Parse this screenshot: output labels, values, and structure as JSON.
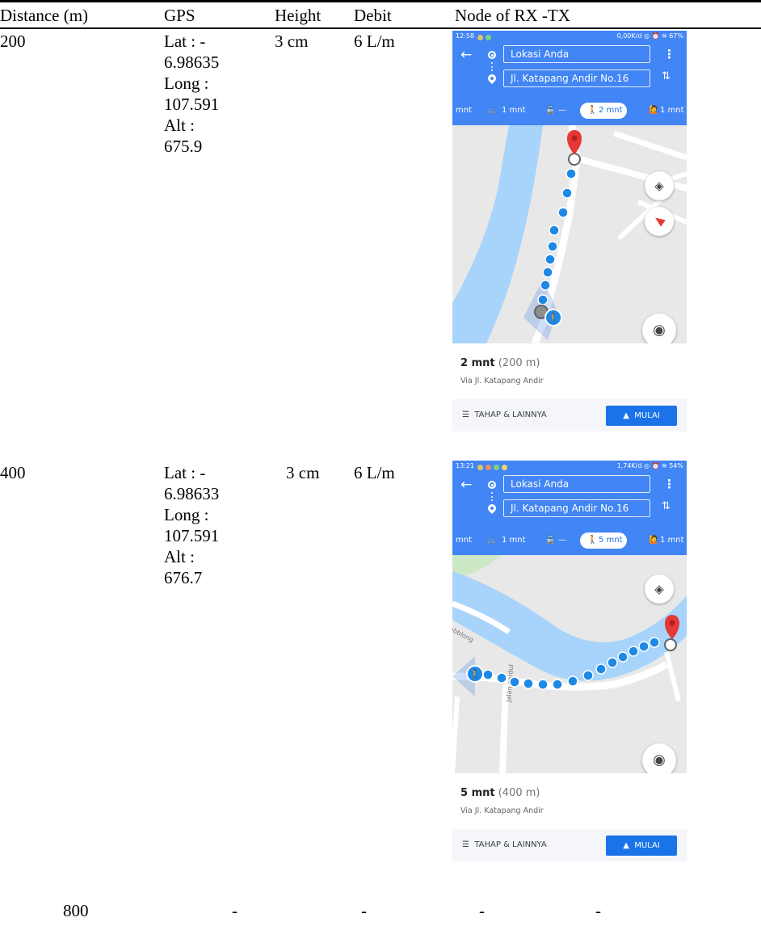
{
  "table": {
    "headers": {
      "distance": "Distance (m)",
      "gps": "GPS",
      "height": "Height",
      "debit": "Debit",
      "node": "Node of RX -TX"
    },
    "rows": [
      {
        "distance": "200",
        "gps": [
          "Lat : -",
          "6.98635",
          "Long :",
          "107.591",
          "Alt :",
          "675.9"
        ],
        "height": "3 cm",
        "debit": "6 L/m"
      },
      {
        "distance": "400",
        "gps": [
          "Lat : -",
          "6.98633",
          "Long :",
          "107.591",
          "Alt :",
          "676.7"
        ],
        "height": "3 cm",
        "debit": "6 L/m"
      },
      {
        "distance": "800",
        "gps": "-",
        "height": "-",
        "debit": "-",
        "node": "-"
      }
    ]
  },
  "screens": [
    {
      "status_time": "12:58",
      "status_right": "0,00K/d ◎ ⏰ ≋ 67%",
      "origin": "Lokasi Anda",
      "destination": "Jl. Katapang Andir No.16",
      "modes": {
        "car": "mnt",
        "bike": "1 mnt",
        "transit": "—",
        "walk": "2 mnt",
        "ride": "1 mnt"
      },
      "eta_time": "2 mnt",
      "eta_distance": "(200 m)",
      "via": "Via Jl. Katapang Andir",
      "steps_label": "TAHAP & LAINNYA",
      "start_label": "MULAI"
    },
    {
      "status_time": "13:21",
      "status_right": "1,74K/d ◎ ⏰ ≋ 54%",
      "origin": "Lokasi Anda",
      "destination": "Jl. Katapang Andir No.16",
      "modes": {
        "car": "mnt",
        "bike": "1 mnt",
        "transit": "—",
        "walk": "5 mnt",
        "ride": "1 mnt"
      },
      "eta_time": "5 mnt",
      "eta_distance": "(400 m)",
      "via": "Via Jl. Katapang Andir",
      "steps_label": "TAHAP & LAINNYA",
      "start_label": "MULAI"
    }
  ],
  "colors": {
    "app_bar": "#4285f4",
    "route_dot": "#1e88e5",
    "river": "#a8d4fb",
    "pin": "#e53935"
  }
}
